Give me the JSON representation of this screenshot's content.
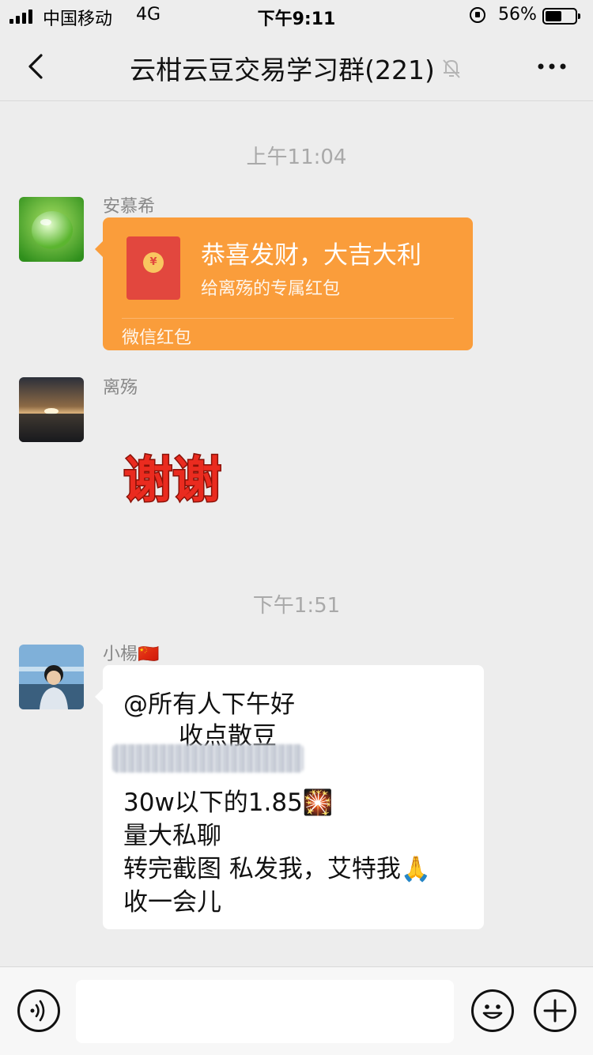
{
  "status_bar": {
    "carrier": "中国移动",
    "network": "4G",
    "time": "下午9:11",
    "battery_percent": "56%",
    "battery_level": 0.56
  },
  "header": {
    "title": "云柑云豆交易学习群(221)",
    "muted": true
  },
  "messages": [
    {
      "type": "time",
      "text": "上午11:04"
    },
    {
      "type": "red_packet",
      "sender": "安慕希",
      "title": "恭喜发财，大吉大利",
      "subtitle": "给离殇的专属红包",
      "footer": "微信红包",
      "coin_symbol": "¥"
    },
    {
      "type": "sticker",
      "sender": "离殇",
      "sticker_text": "谢谢"
    },
    {
      "type": "time",
      "text": "下午1:51"
    },
    {
      "type": "text",
      "sender": "小楊🇨🇳",
      "lines": [
        "@所有人下午好",
        "收点散豆",
        "30w以下的1.85🎇",
        "量大私聊",
        "转完截图 私发我，艾特我🙏",
        "收一会儿"
      ]
    }
  ],
  "colors": {
    "background": "#ededed",
    "red_packet": "#fa9d3b",
    "envelope": "#e2473e",
    "bubble": "#ffffff"
  },
  "icons": [
    "back-icon",
    "mute-icon",
    "more-icon",
    "voice-icon",
    "emoji-icon",
    "plus-icon"
  ]
}
